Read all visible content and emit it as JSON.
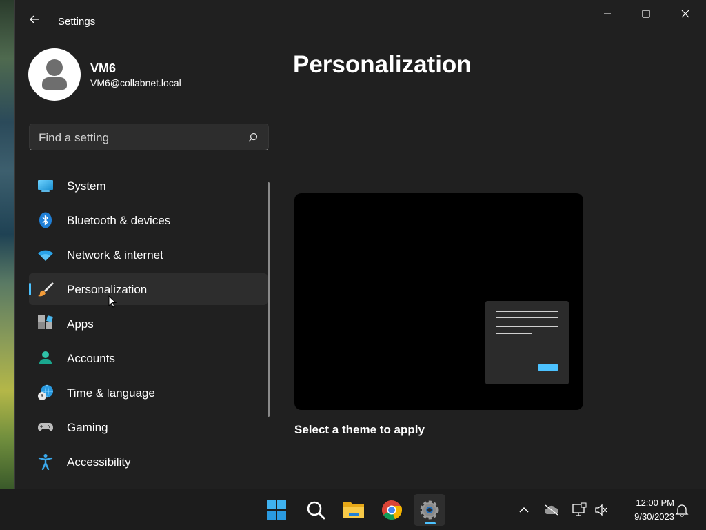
{
  "window": {
    "title": "Settings",
    "back_icon": "back-arrow-icon",
    "controls": [
      "minimize-icon",
      "maximize-icon",
      "close-icon"
    ]
  },
  "user": {
    "name": "VM6",
    "email": "VM6@collabnet.local",
    "avatar_icon": "person-avatar-icon"
  },
  "search": {
    "placeholder": "Find a setting",
    "icon": "search-icon"
  },
  "nav": {
    "selected": "Personalization",
    "accent_color": "#4cc2ff",
    "items": [
      {
        "label": "System",
        "icon": "system-icon"
      },
      {
        "label": "Bluetooth & devices",
        "icon": "bluetooth-icon"
      },
      {
        "label": "Network & internet",
        "icon": "wifi-icon"
      },
      {
        "label": "Personalization",
        "icon": "paintbrush-icon"
      },
      {
        "label": "Apps",
        "icon": "apps-icon"
      },
      {
        "label": "Accounts",
        "icon": "accounts-icon"
      },
      {
        "label": "Time & language",
        "icon": "globe-clock-icon"
      },
      {
        "label": "Gaming",
        "icon": "gamepad-icon"
      },
      {
        "label": "Accessibility",
        "icon": "accessibility-icon"
      }
    ]
  },
  "main": {
    "title": "Personalization",
    "theme_caption": "Select a theme to apply"
  },
  "taskbar": {
    "apps": [
      "windows-start-icon",
      "search-icon",
      "file-explorer-icon",
      "chrome-icon",
      "settings-icon"
    ],
    "active_app": "settings-icon",
    "tray": [
      "chevron-up-icon",
      "onedrive-offline-icon",
      "network-disconnected-icon",
      "volume-muted-icon",
      "notification-bell-icon"
    ],
    "time": "12:00 PM",
    "date": "9/30/2023"
  }
}
